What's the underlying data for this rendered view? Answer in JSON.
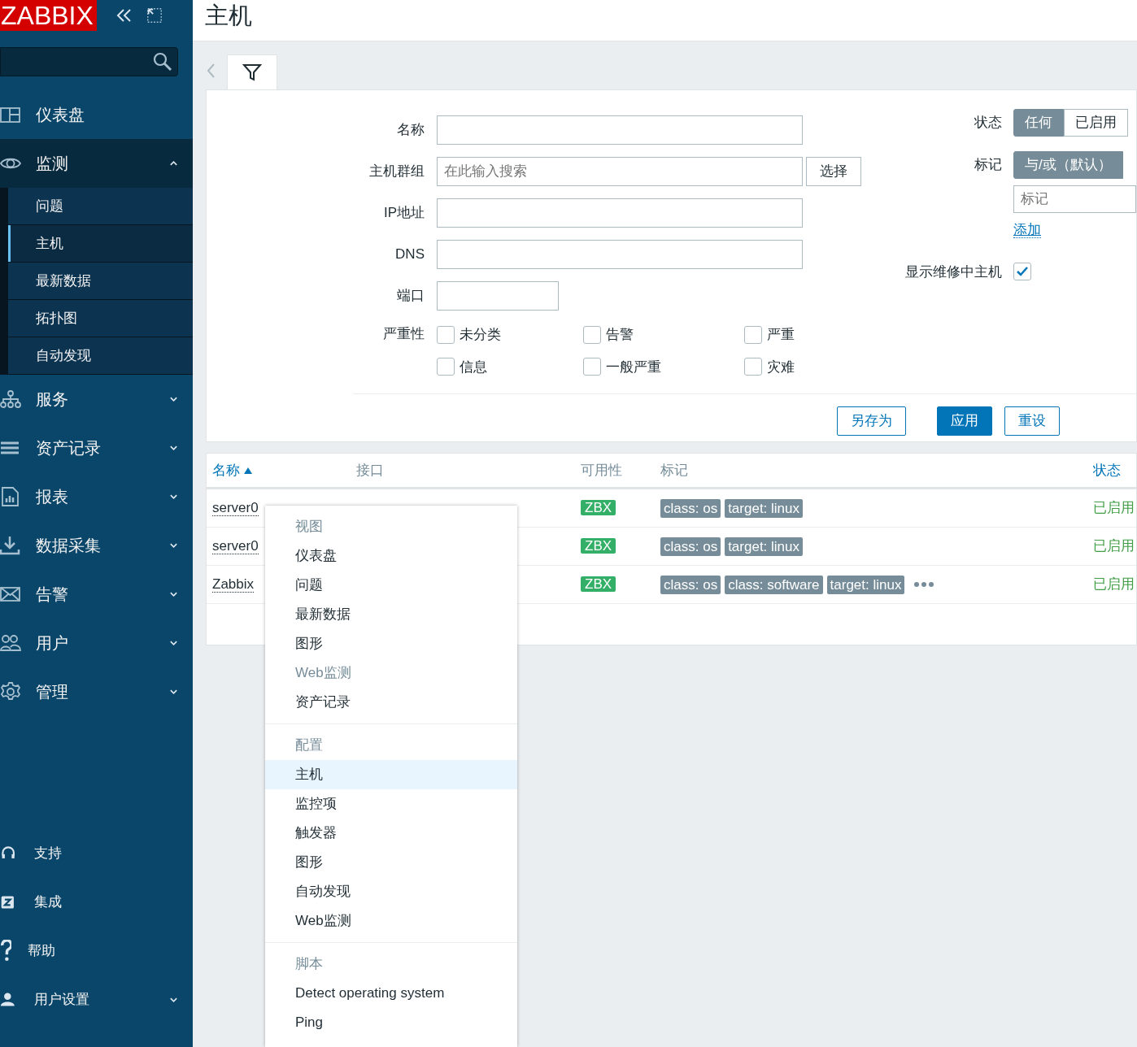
{
  "sidebar": {
    "logo": "ZABBIX",
    "menu": [
      {
        "label": "仪表盘"
      },
      {
        "label": "监测",
        "expanded": true,
        "children": [
          {
            "label": "问题",
            "selected": false
          },
          {
            "label": "主机",
            "selected": true
          },
          {
            "label": "最新数据",
            "selected": false
          },
          {
            "label": "拓扑图",
            "selected": false
          },
          {
            "label": "自动发现",
            "selected": false
          }
        ]
      },
      {
        "label": "服务",
        "expanded": false
      },
      {
        "label": "资产记录",
        "expanded": false
      },
      {
        "label": "报表",
        "expanded": false
      },
      {
        "label": "数据采集",
        "expanded": false
      },
      {
        "label": "告警",
        "expanded": false
      },
      {
        "label": "用户",
        "expanded": false
      },
      {
        "label": "管理",
        "expanded": false
      }
    ],
    "bottom": [
      {
        "label": "支持"
      },
      {
        "label": "集成"
      },
      {
        "label": "帮助"
      },
      {
        "label": "用户设置",
        "expanded": false
      }
    ]
  },
  "page_title": "主机",
  "filter": {
    "fields": [
      {
        "label": "名称",
        "kind": "text"
      },
      {
        "label": "主机群组",
        "kind": "multiselect",
        "placeholder": "在此输入搜索",
        "button": "选择"
      },
      {
        "label": "IP地址",
        "kind": "text"
      },
      {
        "label": "DNS",
        "kind": "text"
      },
      {
        "label": "端口",
        "kind": "short"
      }
    ],
    "severity": {
      "label": "严重性",
      "options": [
        {
          "label": "未分类",
          "checked": false
        },
        {
          "label": "告警",
          "checked": false
        },
        {
          "label": "严重",
          "checked": false
        },
        {
          "label": "信息",
          "checked": false
        },
        {
          "label": "一般严重",
          "checked": false
        },
        {
          "label": "灾难",
          "checked": false
        }
      ]
    },
    "status": {
      "label": "状态",
      "options": [
        {
          "label": "任何",
          "selected": true
        },
        {
          "label": "已启用",
          "selected": false
        }
      ]
    },
    "tags": {
      "label": "标记",
      "options": [
        {
          "label": "与/或（默认）",
          "selected": true
        }
      ],
      "placeholder": "标记",
      "add_link": "添加"
    },
    "maintenance": {
      "label": "显示维修中主机",
      "checked": true
    },
    "buttons": [
      {
        "label": "另存为",
        "kind": "outline"
      },
      {
        "label": "应用",
        "kind": "primary"
      },
      {
        "label": "重设",
        "kind": "outline"
      }
    ]
  },
  "table": {
    "columns": [
      {
        "label": "名称",
        "sorted": true
      },
      {
        "label": "接口"
      },
      {
        "label": "可用性"
      },
      {
        "label": "标记"
      },
      {
        "label": "状态",
        "sorted": false
      }
    ],
    "rows": [
      {
        "name": "server0",
        "availability": "ZBX",
        "tags": [
          "class: os",
          "target: linux"
        ],
        "status": "已启用"
      },
      {
        "name": "server0",
        "availability": "ZBX",
        "tags": [
          "class: os",
          "target: linux"
        ],
        "status": "已启用"
      },
      {
        "name": "Zabbix",
        "availability": "ZBX",
        "tags": [
          "class: os",
          "class: software",
          "target: linux"
        ],
        "more": true,
        "status": "已启用"
      }
    ]
  },
  "context_menu": {
    "sections": [
      {
        "title": "视图",
        "items": [
          {
            "label": "仪表盘",
            "disabled": false,
            "selected": false
          },
          {
            "label": "问题",
            "disabled": false,
            "selected": false
          },
          {
            "label": "最新数据",
            "disabled": false,
            "selected": false
          },
          {
            "label": "图形",
            "disabled": false,
            "selected": false
          },
          {
            "label": "Web监测",
            "disabled": true,
            "selected": false
          },
          {
            "label": "资产记录",
            "disabled": false,
            "selected": false
          }
        ]
      },
      {
        "title": "配置",
        "items": [
          {
            "label": "主机",
            "disabled": false,
            "selected": true
          },
          {
            "label": "监控项",
            "disabled": false,
            "selected": false
          },
          {
            "label": "触发器",
            "disabled": false,
            "selected": false
          },
          {
            "label": "图形",
            "disabled": false,
            "selected": false
          },
          {
            "label": "自动发现",
            "disabled": false,
            "selected": false
          },
          {
            "label": "Web监测",
            "disabled": false,
            "selected": false
          }
        ]
      },
      {
        "title": "脚本",
        "items": [
          {
            "label": "Detect operating system",
            "disabled": false,
            "selected": false
          },
          {
            "label": "Ping",
            "disabled": false,
            "selected": false
          }
        ]
      }
    ]
  }
}
